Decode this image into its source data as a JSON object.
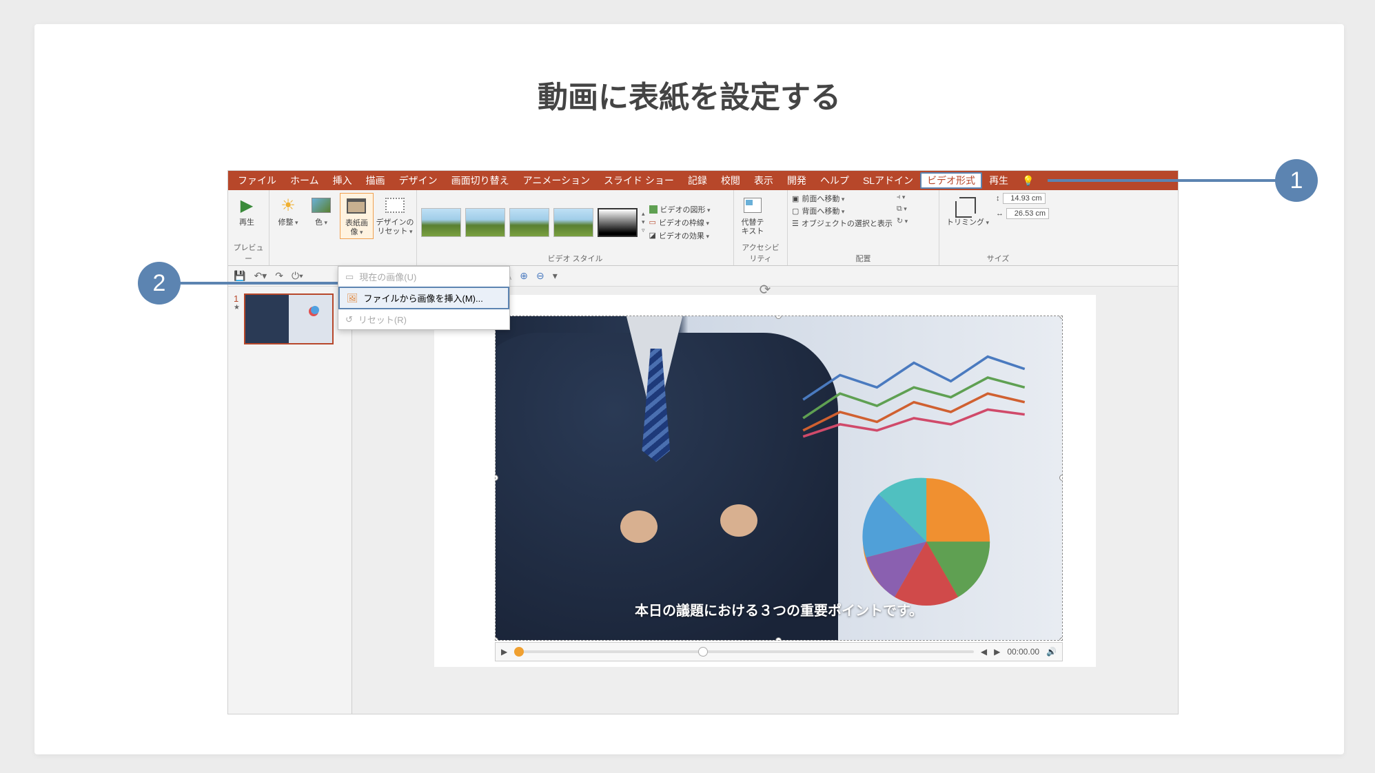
{
  "title": "動画に表紙を設定する",
  "callouts": {
    "one": "1",
    "two": "2"
  },
  "tabs": [
    "ファイル",
    "ホーム",
    "挿入",
    "描画",
    "デザイン",
    "画面切り替え",
    "アニメーション",
    "スライド ショー",
    "記録",
    "校閲",
    "表示",
    "開発",
    "ヘルプ",
    "SLアドイン"
  ],
  "tab_video_format": "ビデオ形式",
  "tab_playback": "再生",
  "ribbon": {
    "preview": {
      "play": "再生",
      "group": "プレビュー"
    },
    "adjust": {
      "correction": "修整",
      "color": "色",
      "poster": "表紙画像",
      "reset": "デザインの\nリセット"
    },
    "styles_group": "ビデオ スタイル",
    "video_opts": {
      "shape": "ビデオの図形",
      "border": "ビデオの枠線",
      "effects": "ビデオの効果"
    },
    "acc": {
      "alt": "代替テ\nキスト",
      "group": "アクセシビリティ"
    },
    "arrange": {
      "front": "前面へ移動",
      "back": "背面へ移動",
      "select": "オブジェクトの選択と表示",
      "group": "配置"
    },
    "crop": {
      "trimming": "トリミング",
      "height": "14.93 cm",
      "width": "26.53 cm",
      "group": "サイズ"
    }
  },
  "poster_menu": {
    "current": "現在の画像(U)",
    "from_file": "ファイルから画像を挿入(M)...",
    "reset": "リセット(R)"
  },
  "thumb": {
    "num": "1",
    "star": "★"
  },
  "caption": "本日の議題における３つの重要ポイントです。",
  "player": {
    "time": "00:00.00"
  }
}
